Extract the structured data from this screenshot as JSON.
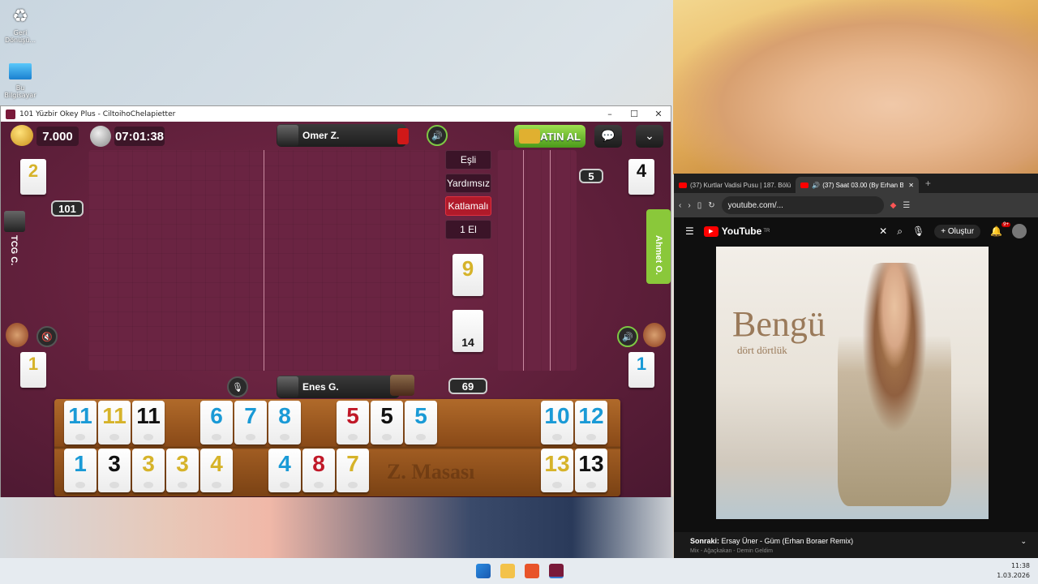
{
  "desktop": {
    "icons": [
      {
        "label": "Geri Dönüşü..."
      },
      {
        "label": "Bu Bilgisayar"
      }
    ]
  },
  "game_window": {
    "title": "101 Yüzbir Okey Plus - CiltoihoChelapietter",
    "coins": "7.000",
    "timer": "07:01:38",
    "buy_label": "SATIN AL",
    "players": {
      "top": "Omer Z.",
      "bottom": "Enes G.",
      "left": "TCG C.",
      "right": "Ahmet O."
    },
    "modes": [
      "Eşli",
      "Yardımsız",
      "Katlamalı",
      "1 El"
    ],
    "active_mode": "Katlamalı",
    "score_101": "101",
    "right_count": "5",
    "remaining": "69",
    "indicator_tile": "9",
    "deck_tile": "14",
    "side_tiles": {
      "top_left": "2",
      "top_right": "4",
      "bottom_left": "1",
      "bottom_right": "1"
    },
    "rack_top": [
      {
        "n": "11",
        "c": "blue"
      },
      {
        "n": "11",
        "c": "yellow"
      },
      {
        "n": "11",
        "c": "black"
      },
      {
        "n": "6",
        "c": "blue"
      },
      {
        "n": "7",
        "c": "blue"
      },
      {
        "n": "8",
        "c": "blue"
      },
      {
        "n": "5",
        "c": "red"
      },
      {
        "n": "5",
        "c": "black"
      },
      {
        "n": "5",
        "c": "blue"
      },
      {
        "n": "10",
        "c": "blue"
      },
      {
        "n": "12",
        "c": "blue"
      }
    ],
    "rack_bottom": [
      {
        "n": "1",
        "c": "blue"
      },
      {
        "n": "3",
        "c": "black"
      },
      {
        "n": "3",
        "c": "yellow"
      },
      {
        "n": "3",
        "c": "yellow"
      },
      {
        "n": "4",
        "c": "yellow"
      },
      {
        "n": "4",
        "c": "blue"
      },
      {
        "n": "8",
        "c": "red"
      },
      {
        "n": "7",
        "c": "yellow"
      },
      {
        "n": "13",
        "c": "yellow"
      },
      {
        "n": "13",
        "c": "black"
      }
    ],
    "rack_watermark": "Z. Masası"
  },
  "browser": {
    "tabs": [
      {
        "label": "(37) Kurtlar Vadisi Pusu | 187. Bölü"
      },
      {
        "label": "(37) Saat 03.00 (By Erhan B"
      }
    ],
    "url": "youtube.com/...",
    "site_name": "YouTube",
    "site_region": "TR",
    "create_label": "Oluştur",
    "notifications": "9+",
    "album_title": "Bengü",
    "album_subtitle": "dört dörtlük",
    "up_next_label": "Sonraki:",
    "up_next_title": "Ersay Üner - Güm (Erhan Boraer Remix)",
    "up_next_sub": "Mix - Ağaçkakan - Demin Geldim"
  },
  "taskbar": {
    "time": "11:38",
    "date": "1.03.2026"
  },
  "colors": {
    "felt": "#5e1f3a",
    "accent_green": "#7ec843",
    "active_mode": "#b01a2a",
    "tile_blue": "#1a9ad6",
    "tile_yellow": "#d6b32a",
    "tile_red": "#c01828"
  }
}
